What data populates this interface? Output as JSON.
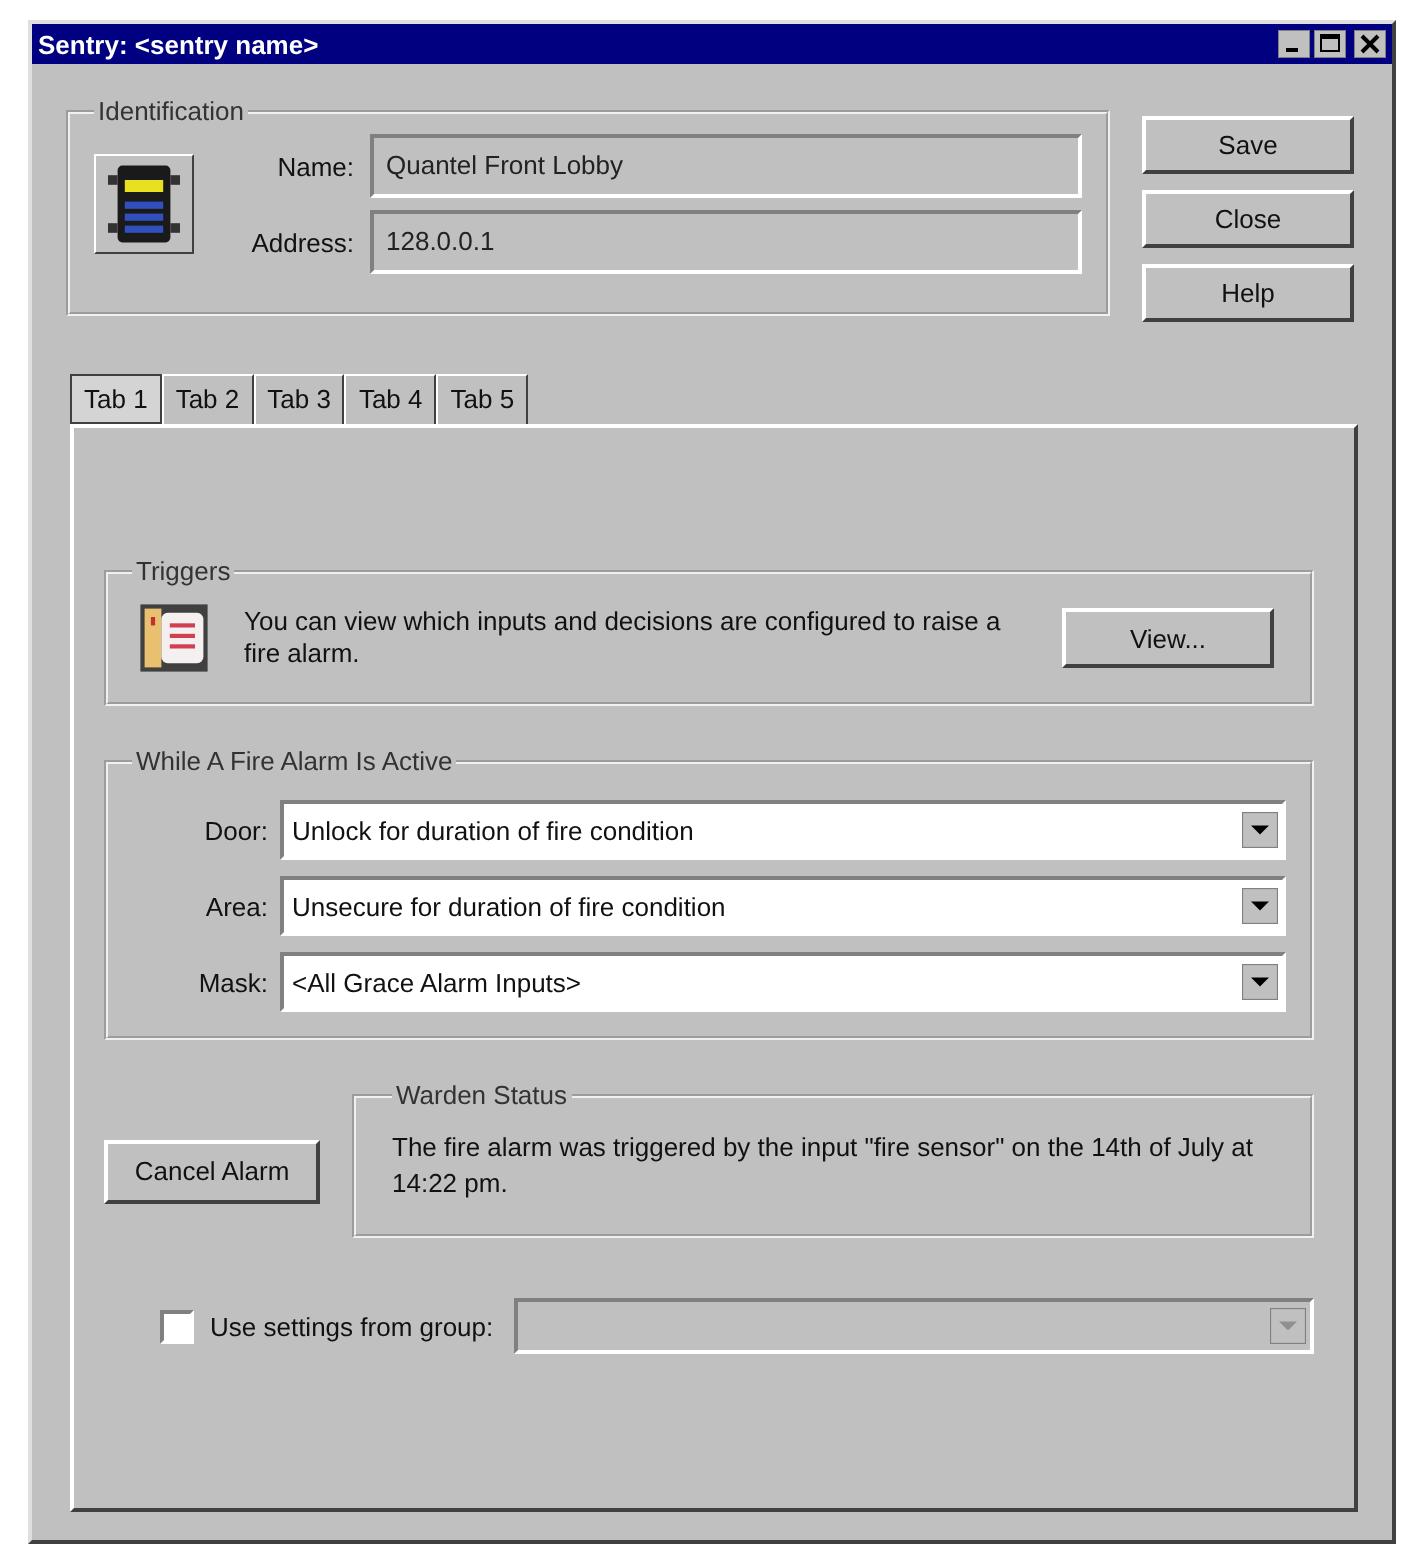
{
  "window": {
    "title": "Sentry: <sentry name>"
  },
  "identification": {
    "legend": "Identification",
    "name_label": "Name:",
    "name_value": "Quantel Front Lobby",
    "address_label": "Address:",
    "address_value": "128.0.0.1"
  },
  "buttons": [
    {
      "label": "Save"
    },
    {
      "label": "Close"
    },
    {
      "label": "Help"
    }
  ],
  "tabs": [
    {
      "label": "Tab 1",
      "selected": true
    },
    {
      "label": "Tab 2",
      "selected": false
    },
    {
      "label": "Tab 3",
      "selected": false
    },
    {
      "label": "Tab 4",
      "selected": false
    },
    {
      "label": "Tab 5",
      "selected": false
    }
  ],
  "triggers": {
    "legend": "Triggers",
    "text": "You can view which inputs and decisions are configured to raise a fire alarm.",
    "button": "View..."
  },
  "while_active": {
    "legend": "While A Fire Alarm Is Active",
    "rows": [
      {
        "label": "Door:",
        "value": "Unlock for duration of fire condition"
      },
      {
        "label": "Area:",
        "value": "Unsecure for duration of fire condition"
      },
      {
        "label": "Mask:",
        "value": "<All Grace Alarm Inputs>"
      }
    ]
  },
  "cancel_button": "Cancel Alarm",
  "warden": {
    "legend": "Warden Status",
    "text": "The fire alarm was triggered by the input \"fire sensor\" on the 14th of July at 14:22 pm."
  },
  "use_group": {
    "label": "Use settings from group:",
    "checked": false,
    "disabled": true
  }
}
